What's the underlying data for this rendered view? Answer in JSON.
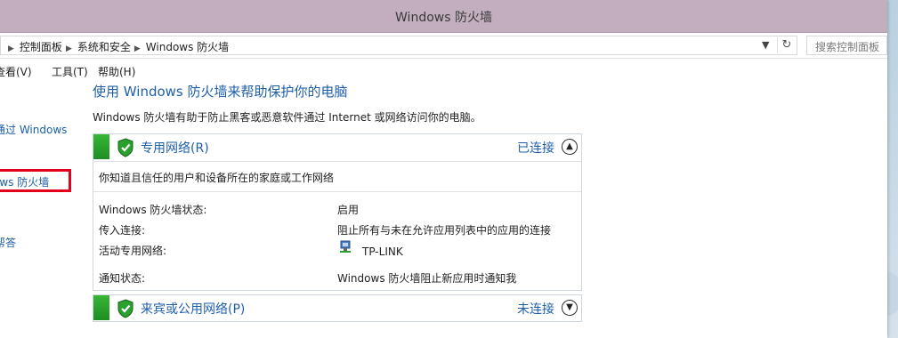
{
  "window": {
    "title": "Windows 防火墙"
  },
  "address": {
    "crumbs": [
      "控制面板",
      "系统和安全",
      "Windows 防火墙"
    ],
    "search_placeholder": "搜索控制面板"
  },
  "menu": {
    "items": [
      "查看(V)",
      "工具(T)",
      "帮助(H)"
    ]
  },
  "left_pane": {
    "links": [
      "通过 Windows",
      "ows 防火墙",
      "帮答"
    ]
  },
  "main": {
    "heading": "使用 Windows 防火墙来帮助保护你的电脑",
    "description": "Windows 防火墙有助于防止黑客或恶意软件通过 Internet 或网络访问你的电脑。",
    "private_network": {
      "title": "专用网络(R)",
      "state": "已连接",
      "subtitle": "你知道且信任的用户和设备所在的家庭或工作网络",
      "rows": [
        {
          "label": "Windows 防火墙状态:",
          "value": "启用"
        },
        {
          "label": "传入连接:",
          "value": "阻止所有与未在允许应用列表中的应用的连接"
        },
        {
          "label": "活动专用网络:",
          "value": "TP-LINK"
        },
        {
          "label": "通知状态:",
          "value": "Windows 防火墙阻止新应用时通知我"
        }
      ]
    },
    "public_network": {
      "title": "来宾或公用网络(P)",
      "state": "未连接"
    }
  },
  "colors": {
    "titlebar": "#c3aebe",
    "link_blue": "#1e5fa9",
    "status_green": "#2aa12e",
    "highlight_red": "#e2001a"
  },
  "icons": [
    "shield-check-icon",
    "chevron-up-icon",
    "chevron-down-icon",
    "network-icon",
    "refresh-icon",
    "dropdown-arrow-icon"
  ]
}
